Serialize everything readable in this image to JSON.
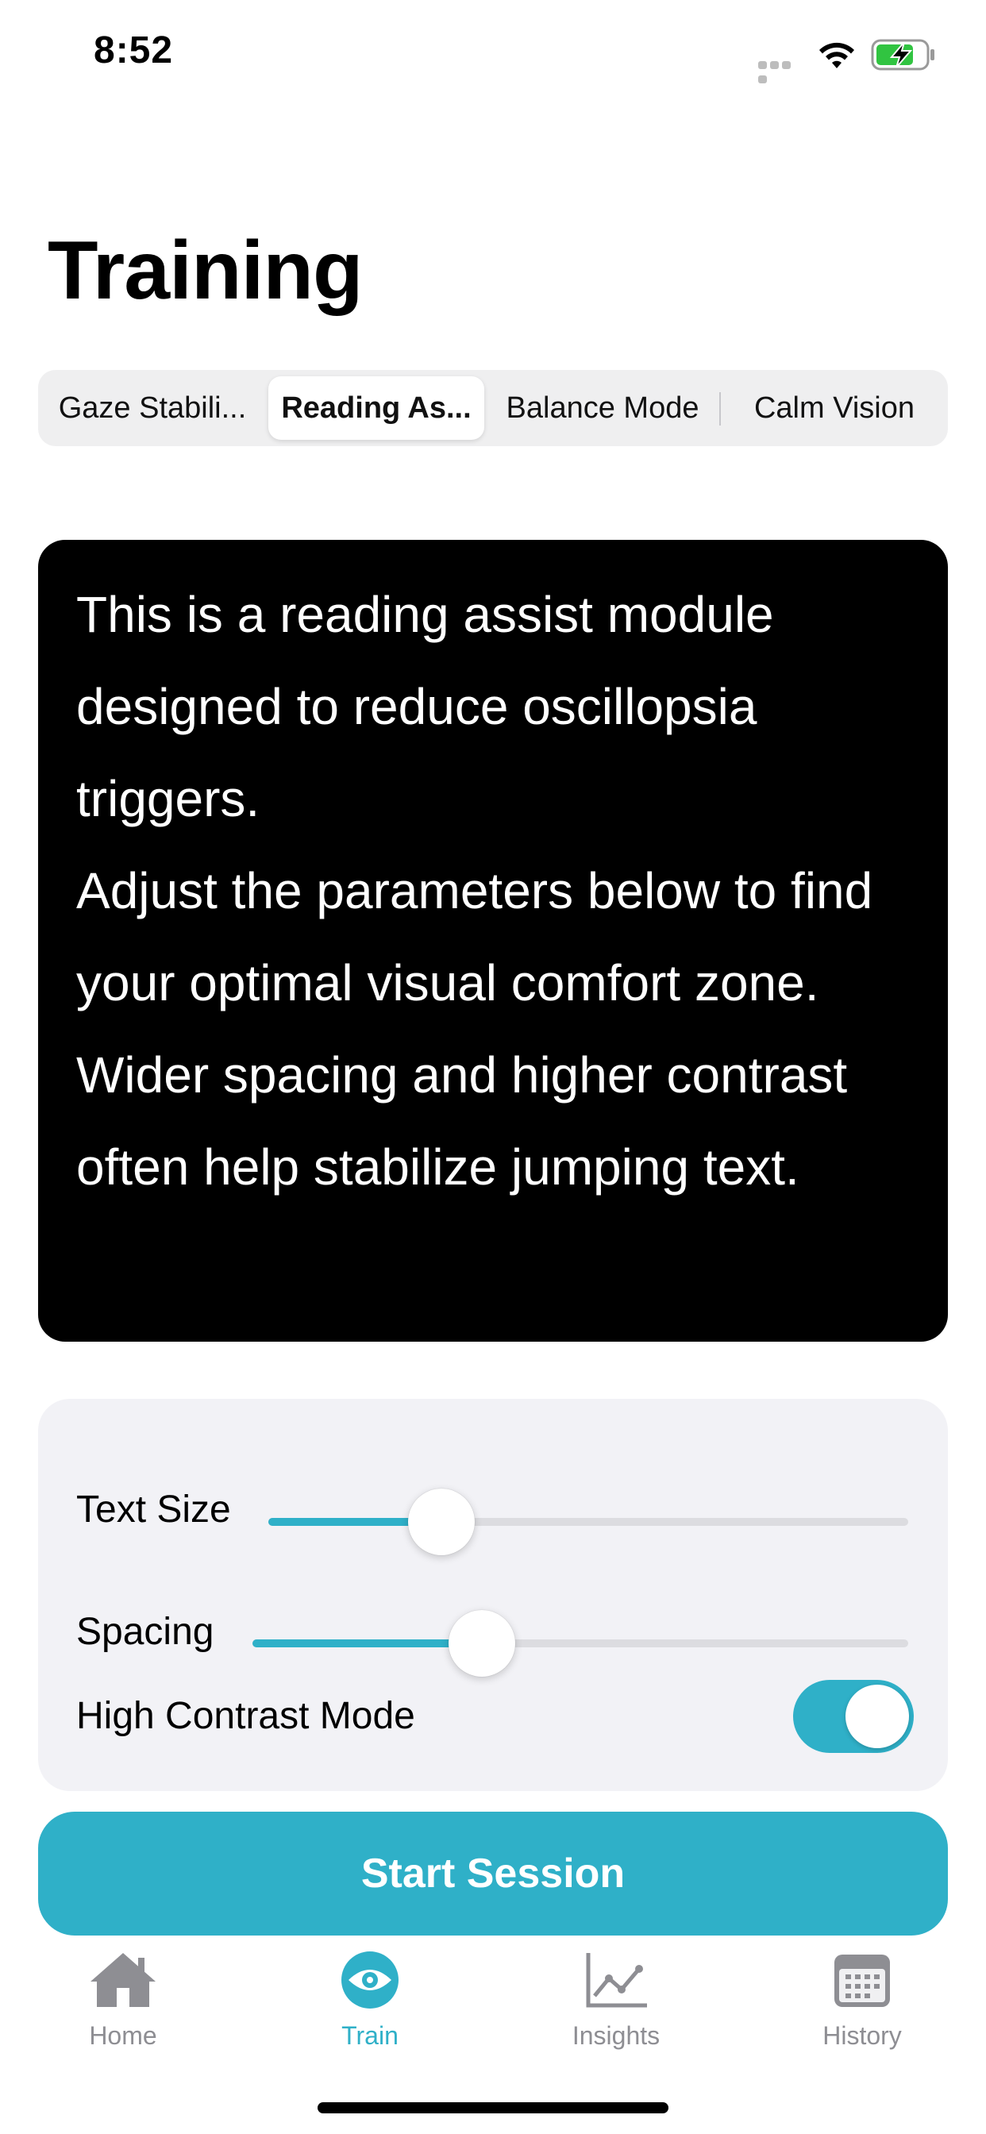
{
  "status_bar": {
    "time": "8:52",
    "icons": [
      "signal-dots-icon",
      "wifi-icon",
      "battery-charging-icon"
    ],
    "battery_color": "#31c441"
  },
  "page": {
    "title": "Training"
  },
  "segments": {
    "items": [
      {
        "label": "Gaze Stabili..."
      },
      {
        "label": "Reading As..."
      },
      {
        "label": "Balance Mode"
      },
      {
        "label": "Calm Vision"
      }
    ],
    "selected_index": 1
  },
  "reading_card": {
    "paragraphs": [
      "This is a reading assist module designed to reduce oscillopsia triggers.",
      "Adjust the parameters below to find your optimal visual comfort zone.",
      "Wider spacing and higher contrast often help stabilize jumping text."
    ],
    "background": "#000000",
    "text_color": "#ffffff"
  },
  "controls": {
    "text_size": {
      "label": "Text Size",
      "value": 0.27
    },
    "spacing": {
      "label": "Spacing",
      "value": 0.35
    },
    "high_contrast": {
      "label": "High Contrast Mode",
      "on": true
    }
  },
  "start_button": {
    "label": "Start Session"
  },
  "tab_bar": {
    "items": [
      {
        "label": "Home",
        "icon": "home-icon"
      },
      {
        "label": "Train",
        "icon": "eye-icon"
      },
      {
        "label": "Insights",
        "icon": "line-chart-icon"
      },
      {
        "label": "History",
        "icon": "calendar-icon"
      }
    ],
    "active_index": 1
  },
  "colors": {
    "accent": "#2fb0c8",
    "inactive_tab": "#8e8e93",
    "card_background": "#f2f2f6"
  }
}
